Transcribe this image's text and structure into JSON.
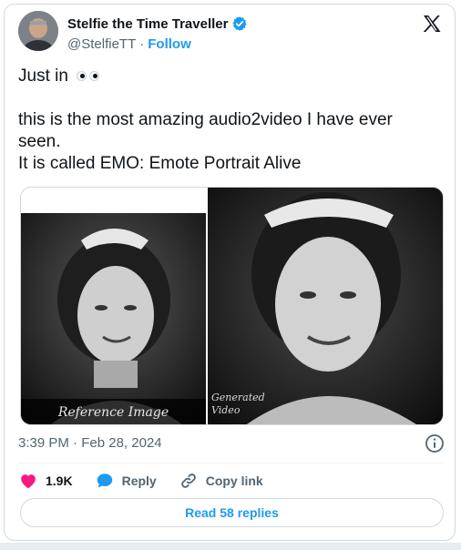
{
  "author": {
    "display_name": "Stelfie the Time Traveller",
    "handle": "@StelfieTT",
    "separator": "·",
    "follow_label": "Follow"
  },
  "tweet": {
    "line1": "Just in",
    "line2": "this is the most amazing audio2video I have ever seen.",
    "line3": "It is called EMO: Emote Portrait Alive"
  },
  "media": {
    "left_caption": "Reference Image",
    "right_caption_line1": "Generated",
    "right_caption_line2": "Video"
  },
  "meta": {
    "time": "3:39 PM",
    "separator": "·",
    "date": "Feb 28, 2024"
  },
  "actions": {
    "like_count": "1.9K",
    "reply_label": "Reply",
    "copy_link_label": "Copy link"
  },
  "read_replies_label": "Read 58 replies",
  "colors": {
    "accent": "#1d9bf0",
    "like": "#f91880",
    "text": "#0f1419",
    "secondary": "#536471",
    "border": "#cfd9de"
  },
  "icons": [
    "verified-badge-icon",
    "x-logo-icon",
    "eyes-emoji-icon",
    "info-icon",
    "heart-icon",
    "reply-bubble-icon",
    "link-icon"
  ]
}
